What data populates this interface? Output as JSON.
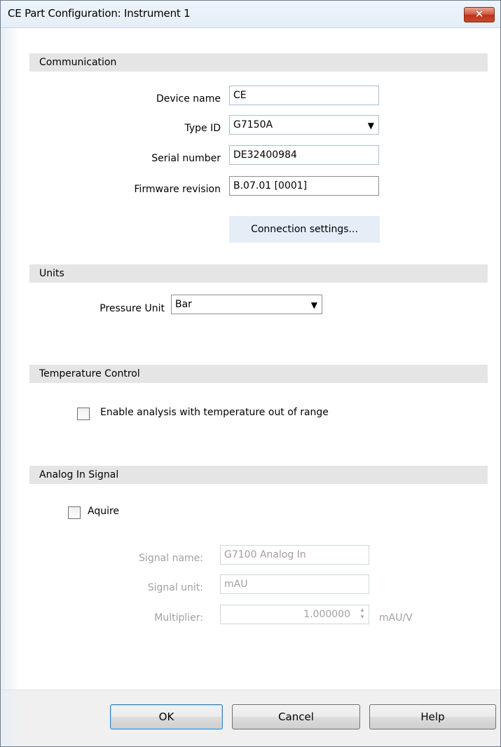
{
  "window": {
    "title": "CE Part Configuration: Instrument 1",
    "close_glyph": "✕"
  },
  "communication": {
    "header": "Communication",
    "device_name_label": "Device name",
    "device_name_value": "CE",
    "type_id_label": "Type ID",
    "type_id_value": "G7150A",
    "serial_number_label": "Serial number",
    "serial_number_value": "DE32400984",
    "firmware_label": "Firmware revision",
    "firmware_value": "B.07.01 [0001]",
    "connection_settings_label": "Connection settings..."
  },
  "units": {
    "header": "Units",
    "pressure_unit_label": "Pressure Unit",
    "pressure_unit_value": "Bar"
  },
  "temperature": {
    "header": "Temperature Control",
    "enable_label": "Enable analysis with temperature out of range",
    "enable_checked": false
  },
  "analog": {
    "header": "Analog In Signal",
    "acquire_label": "Aquire",
    "acquire_checked": false,
    "signal_name_label": "Signal name:",
    "signal_name_value": "G7100 Analog In",
    "signal_unit_label": "Signal unit:",
    "signal_unit_value": "mAU",
    "multiplier_label": "Multiplier:",
    "multiplier_value": "1.000000",
    "multiplier_unit": "mAU/V"
  },
  "footer": {
    "ok_label": "OK",
    "cancel_label": "Cancel",
    "help_label": "Help"
  },
  "icons": {
    "dropdown": "chevron-down-icon",
    "spinner": "spin-arrows-icon",
    "close": "close-icon"
  }
}
